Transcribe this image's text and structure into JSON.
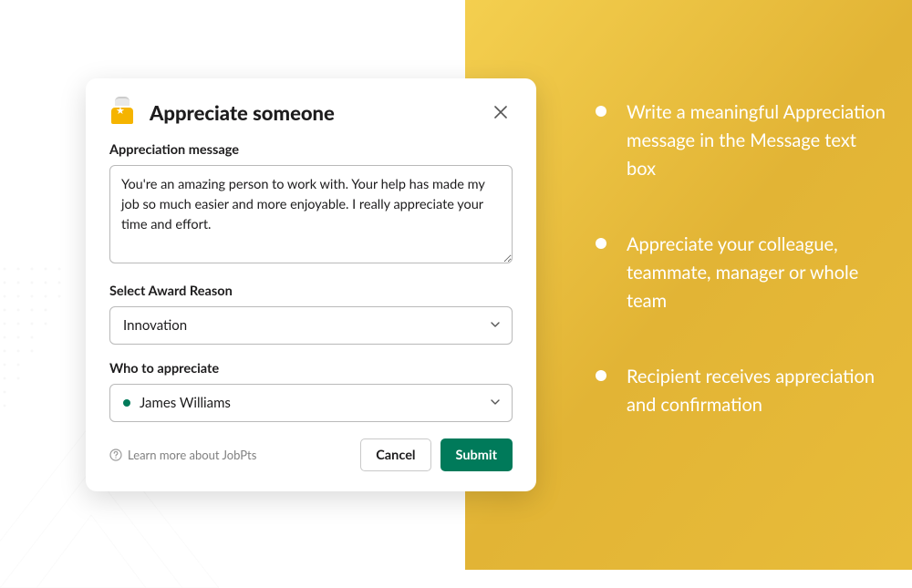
{
  "modal": {
    "title": "Appreciate someone",
    "message_label": "Appreciation message",
    "message_value": "You're an amazing person to work with. Your help has made my job so much easier and more enjoyable. I really appreciate your time and effort.",
    "reason_label": "Select Award Reason",
    "reason_value": "Innovation",
    "recipient_label": "Who to appreciate",
    "recipient_value": "James Williams",
    "learn_more": "Learn more about JobPts",
    "cancel": "Cancel",
    "submit": "Submit"
  },
  "bullets": [
    "Write a meaningful Appreciation message in the Message text box",
    "Appreciate your colleague, teammate, manager or whole team",
    "Recipient receives appreciation and confirmation"
  ]
}
